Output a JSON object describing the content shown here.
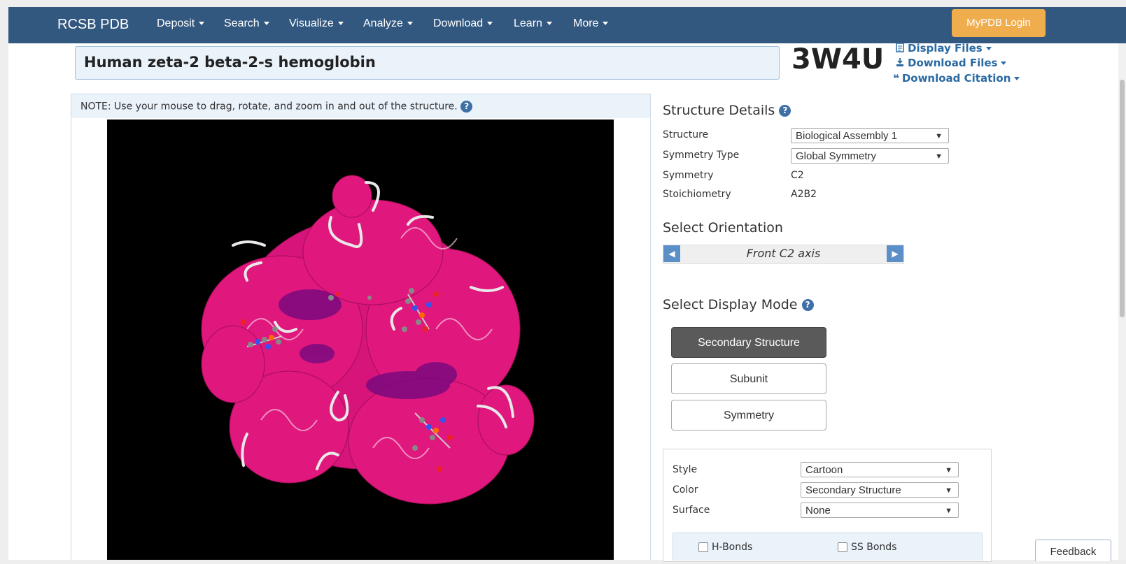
{
  "navbar": {
    "brand": "RCSB PDB",
    "items": [
      {
        "label": "Deposit"
      },
      {
        "label": "Search"
      },
      {
        "label": "Visualize"
      },
      {
        "label": "Analyze"
      },
      {
        "label": "Download"
      },
      {
        "label": "Learn"
      },
      {
        "label": "More"
      }
    ],
    "login": "MyPDB Login"
  },
  "header": {
    "title": "Human zeta-2 beta-2-s hemoglobin",
    "pdb_id": "3W4U",
    "links": {
      "display_files": "Display Files",
      "download_files": "Download Files",
      "download_citation": "Download Citation"
    }
  },
  "viewer": {
    "note": "NOTE: Use your mouse to drag, rotate, and zoom in and out of the structure."
  },
  "structure_details": {
    "heading": "Structure Details",
    "rows": {
      "structure": {
        "label": "Structure",
        "value": "Biological Assembly 1"
      },
      "symmetry_type": {
        "label": "Symmetry Type",
        "value": "Global Symmetry"
      },
      "symmetry": {
        "label": "Symmetry",
        "value": "C2"
      },
      "stoichiometry": {
        "label": "Stoichiometry",
        "value": "A2B2"
      }
    }
  },
  "orientation": {
    "heading": "Select Orientation",
    "value": "Front C2 axis"
  },
  "display_mode": {
    "heading": "Select Display Mode",
    "buttons": {
      "secondary": "Secondary Structure",
      "subunit": "Subunit",
      "symmetry": "Symmetry"
    },
    "active": "Secondary Structure"
  },
  "options": {
    "style": {
      "label": "Style",
      "value": "Cartoon"
    },
    "color": {
      "label": "Color",
      "value": "Secondary Structure"
    },
    "surface": {
      "label": "Surface",
      "value": "None"
    },
    "hbonds": "H-Bonds",
    "ssbonds": "SS Bonds"
  },
  "feedback": "Feedback",
  "colors": {
    "navbar": "#325880",
    "login": "#f0ad4e",
    "helix": "#ff1f8e",
    "sheet": "#8b0a8b",
    "link": "#2b6aa3"
  }
}
